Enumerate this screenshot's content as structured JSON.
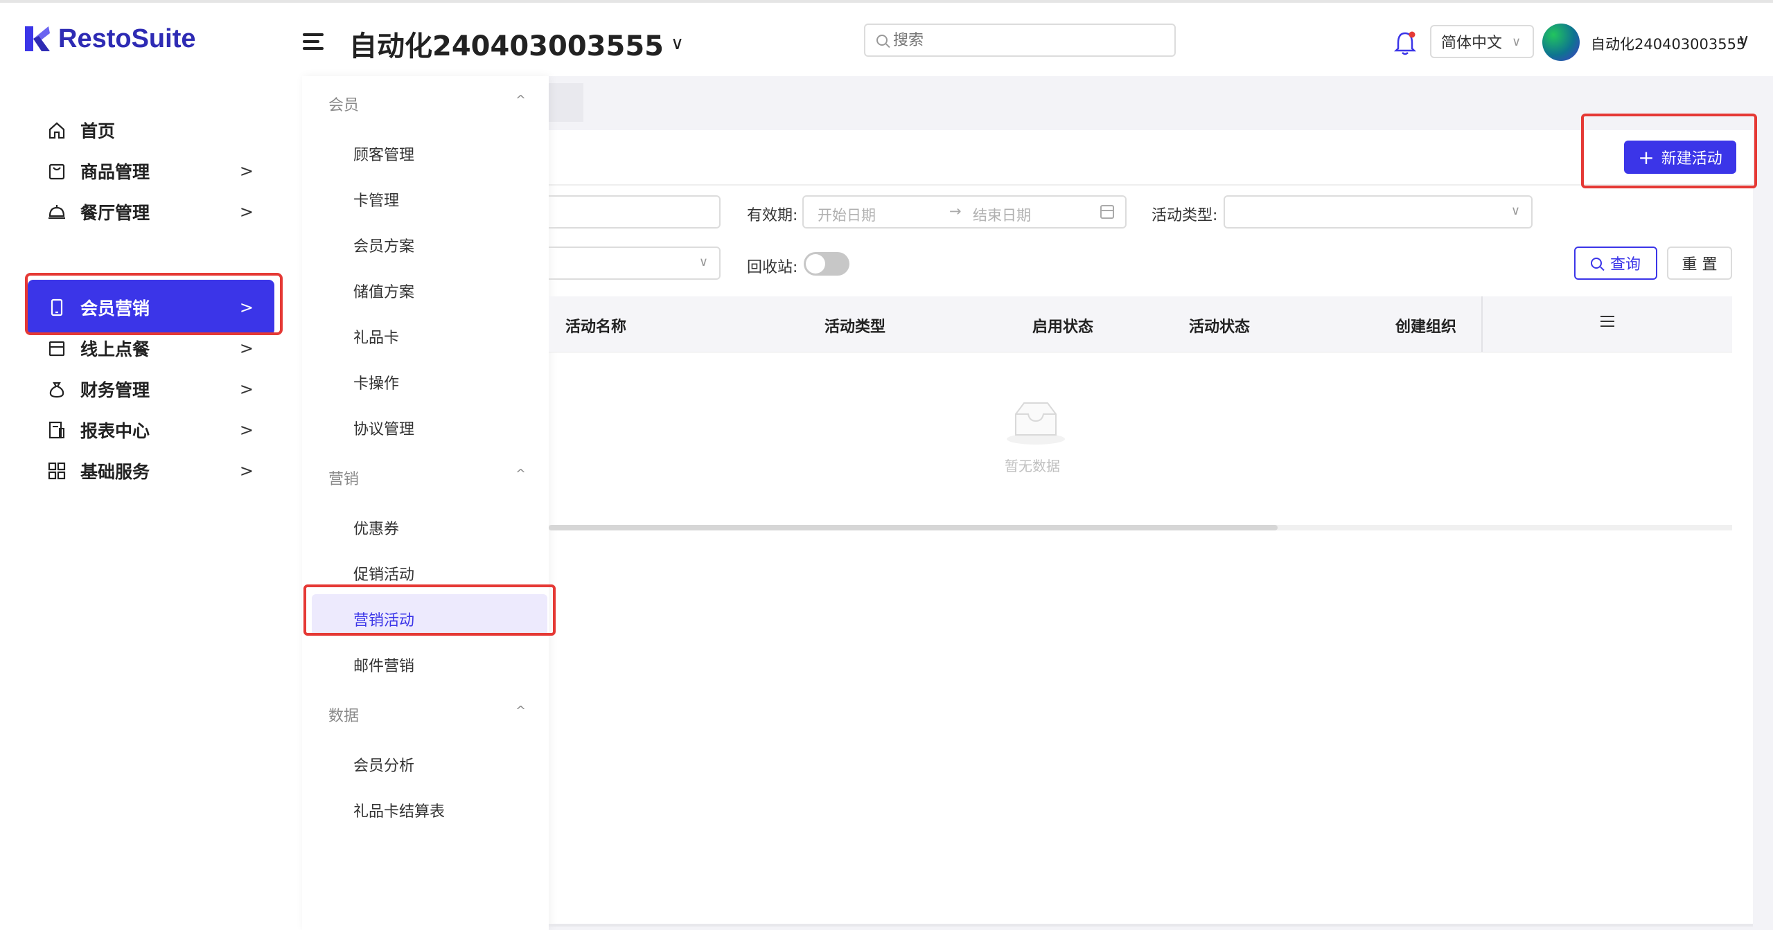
{
  "header": {
    "logo_text": "RestoSuite",
    "store_title": "自动化240403003555",
    "search_placeholder": "搜索",
    "language": "简体中文",
    "username": "自动化240403003555"
  },
  "sidebar": {
    "items": [
      {
        "label": "首页",
        "icon": "home-icon"
      },
      {
        "label": "商品管理",
        "icon": "bag-icon"
      },
      {
        "label": "餐厅管理",
        "icon": "cloche-icon"
      },
      {
        "label": "会员营销",
        "icon": "phone-icon",
        "active": true
      },
      {
        "label": "线上点餐",
        "icon": "tray-icon"
      },
      {
        "label": "财务管理",
        "icon": "money-bag-icon"
      },
      {
        "label": "报表中心",
        "icon": "report-icon"
      },
      {
        "label": "基础服务",
        "icon": "grid-icon"
      }
    ]
  },
  "submenu": {
    "groups": [
      {
        "title": "会员",
        "items": [
          "顾客管理",
          "卡管理",
          "会员方案",
          "储值方案",
          "礼品卡",
          "卡操作",
          "协议管理"
        ]
      },
      {
        "title": "营销",
        "items": [
          "优惠券",
          "促销活动",
          "营销活动",
          "邮件营销"
        ]
      },
      {
        "title": "数据",
        "items": [
          "会员分析",
          "礼品卡结算表"
        ]
      }
    ],
    "active_item": "营销活动"
  },
  "toolbar": {
    "new_button": "新建活动"
  },
  "filters": {
    "validity_label": "有效期:",
    "start_placeholder": "开始日期",
    "end_placeholder": "结束日期",
    "type_label": "活动类型:",
    "recycle_label": "回收站:",
    "recycle_on": false,
    "query_button": "查询",
    "reset_button": "重 置"
  },
  "table": {
    "columns": [
      "活动名称",
      "活动类型",
      "启用状态",
      "活动状态",
      "创建组织"
    ],
    "rows": [],
    "empty_text": "暂无数据"
  },
  "colors": {
    "accent": "#3b35e8",
    "highlight": "#e53935"
  }
}
